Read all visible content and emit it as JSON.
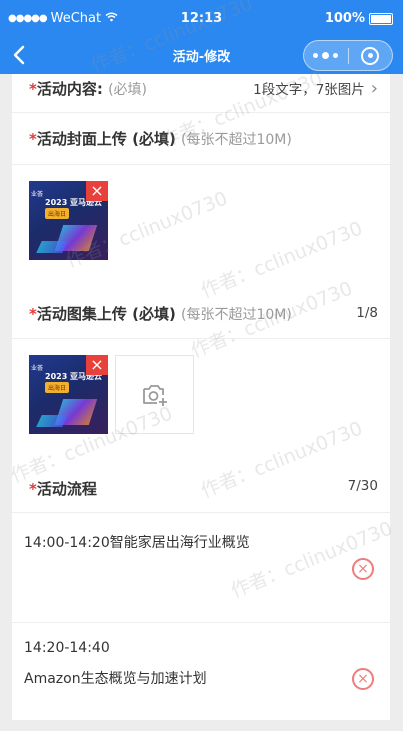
{
  "status_bar": {
    "signal": "●●●●●",
    "carrier": "WeChat",
    "time": "12:13",
    "battery": "100%"
  },
  "nav": {
    "title": "活动-修改"
  },
  "content_row": {
    "label": "活动内容:",
    "hint": "(必填)",
    "summary": "1段文字，7张图片"
  },
  "cover_row": {
    "label": "活动封面上传 (必填)",
    "hint": "(每张不超过10M)"
  },
  "gallery_row": {
    "label": "活动图集上传 (必填)",
    "hint": "(每张不超过10M)",
    "count": "1/8"
  },
  "flow_row": {
    "label": "活动流程",
    "count": "7/30"
  },
  "thumbnail": {
    "year": "2023 亚马逊云科技",
    "banner": "出海日",
    "brand": "业荟"
  },
  "flow_items": [
    {
      "text": "14:00-14:20智能家居出海行业概览"
    },
    {
      "time": "14:20-14:40",
      "text": "Amazon生态概览与加速计划"
    }
  ],
  "watermark": "作者：cclinux0730",
  "colors": {
    "primary": "#2a88f0",
    "required": "#e23b3b",
    "delete": "#e8413b"
  }
}
